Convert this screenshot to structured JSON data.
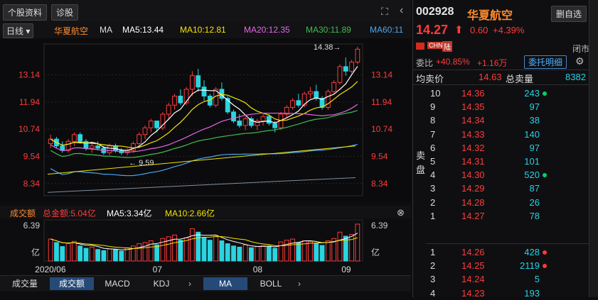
{
  "top": {
    "profile_btn": "个股资料",
    "diagnose_btn": "诊股",
    "expand_icon": "expand-icon",
    "menu_icon": "chevron-left-icon"
  },
  "ma_line": {
    "period": "日线",
    "stock_name": "华夏航空",
    "ma_label": "MA",
    "ma5": "MA5:13.44",
    "ma10": "MA10:12.81",
    "ma20": "MA20:12.35",
    "ma30": "MA30:11.89",
    "ma60": "MA60:11",
    "colors": {
      "ma5": "#ffffff",
      "ma10": "#f5e300",
      "ma20": "#e565e5",
      "ma30": "#3fbd52",
      "ma60": "#4ba6f0"
    }
  },
  "chart": {
    "high_label": "14.38",
    "low_label": "9.59",
    "y_ticks": [
      "13.14",
      "11.94",
      "10.74",
      "9.54",
      "8.34"
    ],
    "x_ticks": [
      "2020/06",
      "07",
      "08",
      "09"
    ]
  },
  "chart_data": {
    "type": "candlestick",
    "x_ticks": [
      "2020/06",
      "07",
      "08",
      "09"
    ],
    "y_ticks": [
      13.14,
      11.94,
      10.74,
      9.54,
      8.34
    ],
    "ylim": [
      7.8,
      14.5
    ],
    "ohlc": [
      [
        10.1,
        10.5,
        9.9,
        10.3
      ],
      [
        10.3,
        10.4,
        9.9,
        10.0
      ],
      [
        10.0,
        10.2,
        9.7,
        9.8
      ],
      [
        9.8,
        10.3,
        9.7,
        10.2
      ],
      [
        10.2,
        10.6,
        10.0,
        10.5
      ],
      [
        10.5,
        10.6,
        10.1,
        10.2
      ],
      [
        10.2,
        10.3,
        9.8,
        9.9
      ],
      [
        9.9,
        10.1,
        9.7,
        10.0
      ],
      [
        10.0,
        10.2,
        9.8,
        9.9
      ],
      [
        9.9,
        10.0,
        9.6,
        9.7
      ],
      [
        9.7,
        10.1,
        9.6,
        10.0
      ],
      [
        10.0,
        10.1,
        9.7,
        9.8
      ],
      [
        9.8,
        9.9,
        9.6,
        9.7
      ],
      [
        9.7,
        9.9,
        9.59,
        9.8
      ],
      [
        9.8,
        10.2,
        9.7,
        10.1
      ],
      [
        10.1,
        10.6,
        10.0,
        10.5
      ],
      [
        10.5,
        10.9,
        10.3,
        10.8
      ],
      [
        10.8,
        11.2,
        10.6,
        11.1
      ],
      [
        11.1,
        11.0,
        10.6,
        10.8
      ],
      [
        10.8,
        11.5,
        10.7,
        11.4
      ],
      [
        11.4,
        11.9,
        11.2,
        11.8
      ],
      [
        11.8,
        12.3,
        11.6,
        12.2
      ],
      [
        12.2,
        12.5,
        11.8,
        11.9
      ],
      [
        11.9,
        12.6,
        11.8,
        12.5
      ],
      [
        12.5,
        13.3,
        12.2,
        13.1
      ],
      [
        13.1,
        13.4,
        12.4,
        12.6
      ],
      [
        12.6,
        12.9,
        12.0,
        12.2
      ],
      [
        12.2,
        12.3,
        11.7,
        11.8
      ],
      [
        11.8,
        12.6,
        11.7,
        12.5
      ],
      [
        12.5,
        12.8,
        12.0,
        12.1
      ],
      [
        12.1,
        12.2,
        11.4,
        11.5
      ],
      [
        11.5,
        11.6,
        11.0,
        11.1
      ],
      [
        11.1,
        11.4,
        10.8,
        10.9
      ],
      [
        10.9,
        11.3,
        10.7,
        11.2
      ],
      [
        11.2,
        11.3,
        10.8,
        10.9
      ],
      [
        10.9,
        11.2,
        10.7,
        11.1
      ],
      [
        11.1,
        11.4,
        10.9,
        11.3
      ],
      [
        11.3,
        11.4,
        10.9,
        11.0
      ],
      [
        11.0,
        11.1,
        10.6,
        10.8
      ],
      [
        10.8,
        11.5,
        10.7,
        11.4
      ],
      [
        11.4,
        11.8,
        11.2,
        11.7
      ],
      [
        11.7,
        12.1,
        11.6,
        12.0
      ],
      [
        12.0,
        12.3,
        11.7,
        11.8
      ],
      [
        11.8,
        12.4,
        11.7,
        12.3
      ],
      [
        12.3,
        12.6,
        12.1,
        12.4
      ],
      [
        12.4,
        12.7,
        12.0,
        12.1
      ],
      [
        12.1,
        12.2,
        11.6,
        11.7
      ],
      [
        11.7,
        12.5,
        11.6,
        12.4
      ],
      [
        12.4,
        12.9,
        12.3,
        12.8
      ],
      [
        12.8,
        13.6,
        12.7,
        13.5
      ],
      [
        13.5,
        13.9,
        13.1,
        13.3
      ],
      [
        13.3,
        13.8,
        13.2,
        13.7
      ],
      [
        13.7,
        14.38,
        13.6,
        14.27
      ]
    ],
    "volume": [
      3.8,
      3.2,
      2.5,
      3.0,
      3.4,
      2.6,
      2.2,
      2.4,
      2.0,
      1.8,
      2.1,
      2.0,
      1.7,
      2.3,
      2.6,
      3.0,
      3.2,
      3.5,
      2.8,
      3.9,
      4.2,
      4.5,
      3.6,
      4.0,
      5.6,
      5.0,
      4.1,
      3.6,
      4.2,
      3.5,
      3.0,
      2.6,
      2.4,
      2.8,
      2.3,
      2.5,
      2.7,
      2.6,
      2.2,
      3.3,
      3.6,
      3.8,
      3.2,
      3.5,
      3.4,
      3.0,
      2.7,
      3.5,
      3.9,
      5.0,
      4.3,
      4.6,
      6.39
    ],
    "volume_ylim": [
      0,
      6.39
    ]
  },
  "volume_panel": {
    "title": "成交额",
    "total": "总金额:5.04亿",
    "ma5": "MA5:3.34亿",
    "ma10": "MA10:2.66亿",
    "y_top": "6.39",
    "y_unit": "亿"
  },
  "bottom_tabs": [
    "成交量",
    "成交额",
    "MACD",
    "KDJ",
    "MA",
    "BOLL"
  ],
  "right": {
    "code": "002928",
    "name": "华夏航空",
    "add_btn": "删自选",
    "price": "14.27",
    "change": "0.60",
    "pct": "+4.39%",
    "tags": [
      "CHN",
      "陆"
    ],
    "status": "闭市",
    "ratio_label": "委比",
    "ratio": "+40.85%",
    "ratio_diff": "+1.16万",
    "detail_btn": "委托明细",
    "avg_label": "均卖价",
    "avg": "14.63",
    "total_label": "总卖量",
    "total": "8382",
    "sell_label": "卖盘",
    "sells": [
      {
        "n": "10",
        "p": "14.36",
        "v": "243",
        "dot": "green"
      },
      {
        "n": "9",
        "p": "14.35",
        "v": "97",
        "dot": ""
      },
      {
        "n": "8",
        "p": "14.34",
        "v": "38",
        "dot": ""
      },
      {
        "n": "7",
        "p": "14.33",
        "v": "140",
        "dot": ""
      },
      {
        "n": "6",
        "p": "14.32",
        "v": "97",
        "dot": ""
      },
      {
        "n": "5",
        "p": "14.31",
        "v": "101",
        "dot": ""
      },
      {
        "n": "4",
        "p": "14.30",
        "v": "520",
        "dot": "green"
      },
      {
        "n": "3",
        "p": "14.29",
        "v": "87",
        "dot": ""
      },
      {
        "n": "2",
        "p": "14.28",
        "v": "26",
        "dot": ""
      },
      {
        "n": "1",
        "p": "14.27",
        "v": "78",
        "dot": ""
      }
    ],
    "buys": [
      {
        "n": "1",
        "p": "14.26",
        "v": "428",
        "dot": "red"
      },
      {
        "n": "2",
        "p": "14.25",
        "v": "2119",
        "dot": "red"
      },
      {
        "n": "3",
        "p": "14.24",
        "v": "5",
        "dot": ""
      },
      {
        "n": "4",
        "p": "14.23",
        "v": "193",
        "dot": ""
      }
    ]
  }
}
